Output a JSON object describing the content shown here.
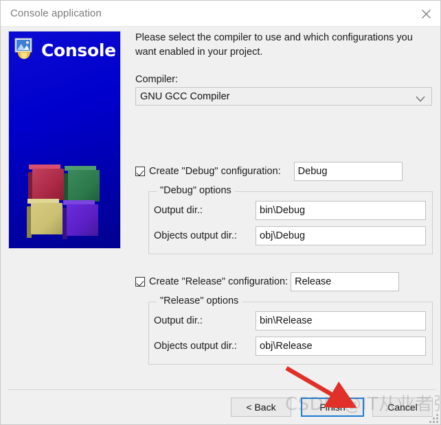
{
  "window": {
    "title": "Console application",
    "close_icon": "close-icon"
  },
  "banner": {
    "title": "Console",
    "logo_icon": "console-app-icon",
    "cubes_icon": "four-cubes-graphic",
    "colors": {
      "background": "#0000cd",
      "cube_red": "#b02a4a",
      "cube_green": "#2d7a4d",
      "cube_yellow": "#cdc274",
      "cube_purple": "#5a1fc4"
    }
  },
  "main": {
    "intro": "Please select the compiler to use and which configurations you want enabled in your project.",
    "compiler_label": "Compiler:",
    "compiler_value": "GNU GCC Compiler",
    "compiler_options": [
      "GNU GCC Compiler"
    ],
    "dropdown_icon": "chevron-down-icon"
  },
  "debug": {
    "checkbox_label": "Create \"Debug\" configuration:",
    "checked": true,
    "name_value": "Debug",
    "group_legend": "\"Debug\" options",
    "fields": [
      {
        "label": "Output dir.:",
        "value": "bin\\Debug"
      },
      {
        "label": "Objects output dir.:",
        "value": "obj\\Debug"
      }
    ]
  },
  "release": {
    "checkbox_label": "Create \"Release\" configuration:",
    "checked": true,
    "name_value": "Release",
    "group_legend": "\"Release\" options",
    "fields": [
      {
        "label": "Output dir.:",
        "value": "bin\\Release"
      },
      {
        "label": "Objects output dir.:",
        "value": "obj\\Release"
      }
    ]
  },
  "footer": {
    "back_label": "< Back",
    "finish_label": "Finish",
    "cancel_label": "Cancel",
    "focused_button": "Finish",
    "focus_color": "#1a7bd4"
  },
  "annotation": {
    "arrow_icon": "red-arrow-pointing-to-finish",
    "arrow_color": "#e03028"
  },
  "watermark": {
    "text": "CSDN @IT从业者张某某"
  }
}
